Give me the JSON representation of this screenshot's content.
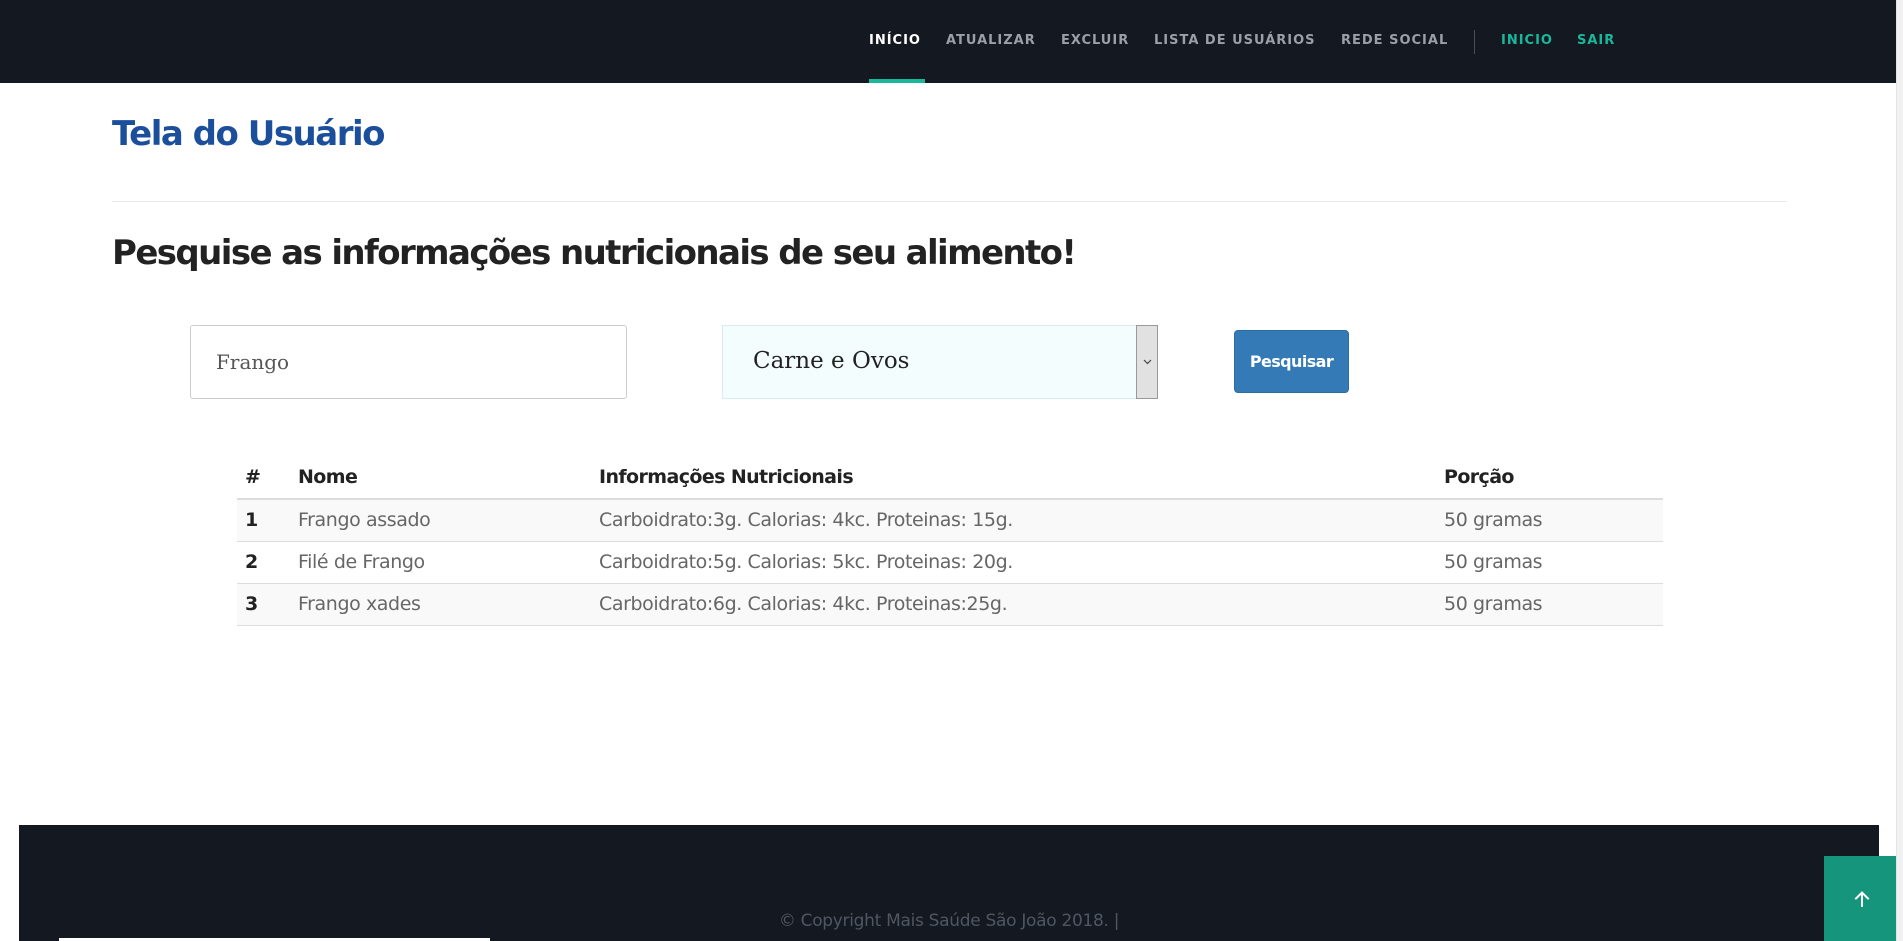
{
  "nav": {
    "items": [
      {
        "label": "INÍCIO",
        "active": true
      },
      {
        "label": "ATUALIZAR"
      },
      {
        "label": "EXCLUIR"
      },
      {
        "label": "LISTA DE USUÁRIOS"
      },
      {
        "label": "REDE SOCIAL"
      }
    ],
    "right_items": [
      {
        "label": "INICIO"
      },
      {
        "label": "SAIR"
      }
    ]
  },
  "page": {
    "title": "Tela do Usuário",
    "heading": "Pesquise as informações nutricionais de seu alimento!"
  },
  "search": {
    "value": "Frango",
    "category": "Carne e Ovos",
    "button_label": "Pesquisar"
  },
  "table": {
    "headers": [
      "#",
      "Nome",
      "Informações Nutricionais",
      "Porção"
    ],
    "rows": [
      [
        "1",
        "Frango assado",
        "Carboidrato:3g. Calorias: 4kc. Proteinas: 15g.",
        "50 gramas"
      ],
      [
        "2",
        "Filé de Frango",
        "Carboidrato:5g. Calorias: 5kc. Proteinas: 20g.",
        "50 gramas"
      ],
      [
        "3",
        "Frango xades",
        "Carboidrato:6g. Calorias: 4kc. Proteinas:25g.",
        "50 gramas"
      ]
    ]
  },
  "footer": {
    "copyright": "© Copyright Mais Saúde São João 2018. |"
  },
  "colors": {
    "nav_bg": "#141820",
    "accent": "#1ab89a",
    "title": "#1b4f9c",
    "button": "#337ab7",
    "back_to_top": "#14957c"
  },
  "icons": {
    "back_to_top": "arrow-up-icon",
    "select": "chevron-down-icon"
  }
}
